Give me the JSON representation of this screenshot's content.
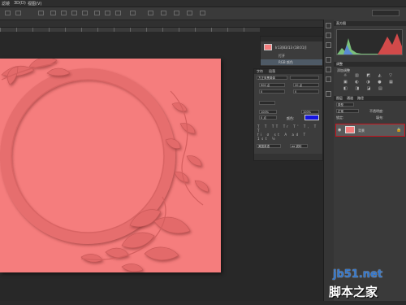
{
  "menu": {
    "items": [
      "滤镜",
      "3D(D)",
      "视图(V)"
    ]
  },
  "options": {
    "search_value": ""
  },
  "history_panel": {
    "snapshot_label": "Ir13[83/13 (18:01)]",
    "item_open": "打开",
    "item_rgb": "RGB 颜色"
  },
  "char_panel": {
    "tab_char": "字符",
    "tab_para": "段落",
    "font_family": "方正宋黑简体",
    "font_size": "900 点",
    "leading": "20 点",
    "kerning": "0",
    "tracking": "0",
    "scale_v": "100%",
    "scale_h": "100%",
    "baseline": "0 点",
    "color_label": "颜色:",
    "lang": "美国英语",
    "aa": "aa 锐利"
  },
  "right_panels": {
    "histogram_tab": "直方图",
    "adjust_tab": "调整",
    "adjust_sub": "添加调整",
    "layers_tab": "图层",
    "channels_tab": "通道",
    "paths_tab": "路径",
    "layer_kind": "类型",
    "blend_mode": "正常",
    "opacity": "不透明度:",
    "fill": "填充:",
    "lock": "锁定:",
    "layer_name": "背景"
  },
  "watermark": {
    "line1": "jb51.net",
    "line2": "脚本之家"
  },
  "colors": {
    "canvas": "#f57d7d",
    "selection_border": "#c8141e",
    "text_color_swatch": "#1515e0"
  }
}
